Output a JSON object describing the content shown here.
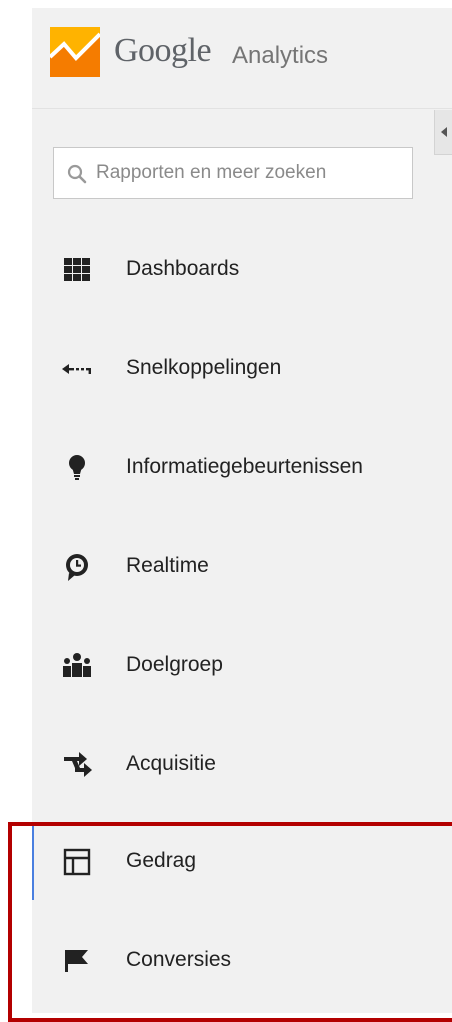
{
  "brand": {
    "google": "Google",
    "analytics": "Analytics"
  },
  "search": {
    "placeholder": "Rapporten en meer zoeken",
    "value": ""
  },
  "nav": {
    "items": [
      {
        "label": "Dashboards",
        "icon": "grid-icon"
      },
      {
        "label": "Snelkoppelingen",
        "icon": "shortcut-arrow-icon"
      },
      {
        "label": "Informatiegebeurtenissen",
        "icon": "lightbulb-icon"
      },
      {
        "label": "Realtime",
        "icon": "clock-icon"
      },
      {
        "label": "Doelgroep",
        "icon": "people-icon"
      },
      {
        "label": "Acquisitie",
        "icon": "arrows-icon"
      },
      {
        "label": "Gedrag",
        "icon": "layout-icon",
        "active": true
      },
      {
        "label": "Conversies",
        "icon": "flag-icon"
      }
    ]
  },
  "colors": {
    "sidebar_bg": "#f1f1f1",
    "active_indicator": "#4a7fe0",
    "highlight_border": "#b30000",
    "logo_orange": "#f57c00",
    "logo_yellow": "#ffb300"
  }
}
